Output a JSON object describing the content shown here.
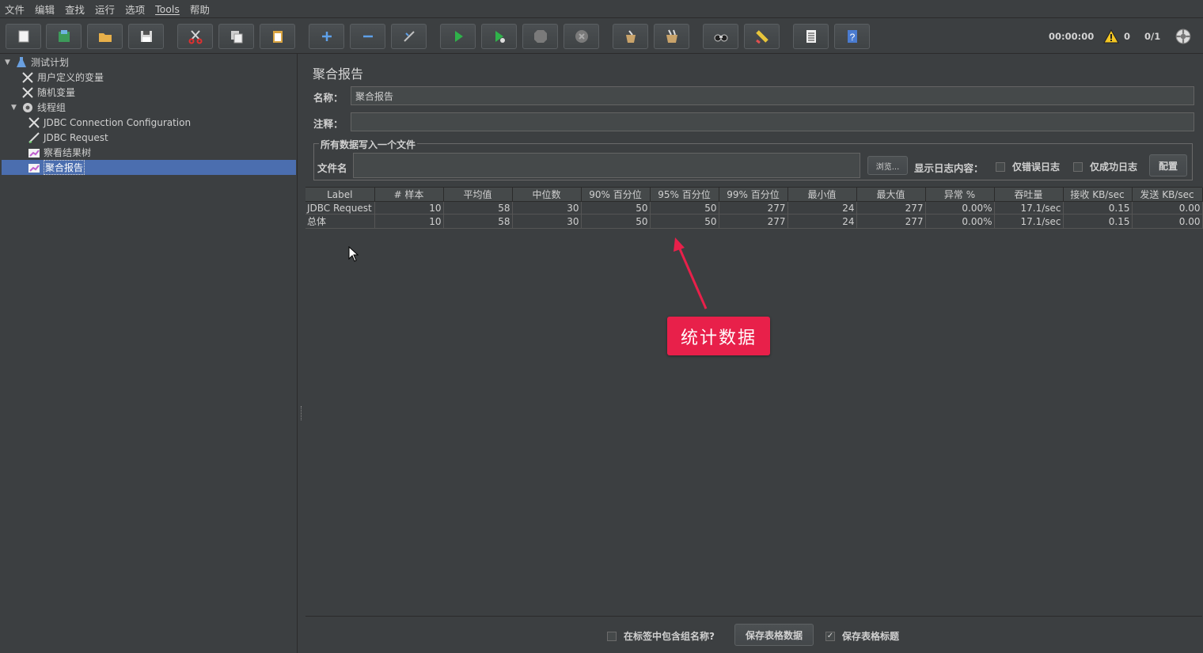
{
  "menu": [
    "文件",
    "编辑",
    "查找",
    "运行",
    "选项",
    "Tools",
    "帮助"
  ],
  "toolbar": {
    "buttons": [
      "new-file-icon",
      "template-icon",
      "open-folder-icon",
      "save-icon",
      "cut-icon",
      "copy-icon",
      "paste-icon",
      "expand-icon",
      "collapse-icon",
      "toggle-icon",
      "start-icon",
      "start-no-pause-icon",
      "stop-icon",
      "shutdown-icon",
      "clear-icon",
      "clear-all-icon",
      "search-icon",
      "reset-search-icon",
      "function-helper-icon",
      "help-icon"
    ],
    "elapsed_time": "00:00:00",
    "warning_count": "0",
    "threads": "0/1"
  },
  "tree": [
    {
      "label": "测试计划",
      "icon": "test-plan-icon",
      "expanded": true,
      "level": 0
    },
    {
      "label": "用户定义的变量",
      "icon": "config-element-icon",
      "level": 1
    },
    {
      "label": "随机变量",
      "icon": "config-element-icon",
      "level": 1
    },
    {
      "label": "线程组",
      "icon": "thread-group-icon",
      "expanded": true,
      "level": 1
    },
    {
      "label": "JDBC Connection Configuration",
      "icon": "config-element-icon",
      "level": 2
    },
    {
      "label": "JDBC Request",
      "icon": "sampler-icon",
      "level": 2
    },
    {
      "label": "察看结果树",
      "icon": "listener-icon",
      "level": 2
    },
    {
      "label": "聚合报告",
      "icon": "listener-icon",
      "level": 2,
      "selected": true
    }
  ],
  "panel": {
    "title": "聚合报告",
    "name_label": "名称：",
    "name_value": "聚合报告",
    "comment_label": "注释：",
    "comment_value": "",
    "file_group_legend": "所有数据写入一个文件",
    "filename_label": "文件名",
    "filename_value": "",
    "browse_button": "浏览...",
    "log_content_label": "显示日志内容：",
    "errors_only_label": "仅错误日志",
    "success_only_label": "仅成功日志",
    "configure_button": "配置"
  },
  "table": {
    "headers": [
      "Label",
      "# 样本",
      "平均值",
      "中位数",
      "90% 百分位",
      "95% 百分位",
      "99% 百分位",
      "最小值",
      "最大值",
      "异常 %",
      "吞吐量",
      "接收 KB/sec",
      "发送 KB/sec"
    ],
    "rows": [
      [
        "JDBC Request",
        "10",
        "58",
        "30",
        "50",
        "50",
        "277",
        "24",
        "277",
        "0.00%",
        "17.1/sec",
        "0.15",
        "0.00"
      ],
      [
        "总体",
        "10",
        "58",
        "30",
        "50",
        "50",
        "277",
        "24",
        "277",
        "0.00%",
        "17.1/sec",
        "0.15",
        "0.00"
      ]
    ]
  },
  "bottom": {
    "include_group_label": "在标签中包含组名称?",
    "include_group_checked": false,
    "save_table_button": "保存表格数据",
    "save_header_label": "保存表格标题",
    "save_header_checked": true
  },
  "annotation": {
    "text": "统计数据",
    "color": "#e8204a"
  },
  "colors": {
    "background": "#3c3f41",
    "selection": "#4b6eaf",
    "accent": "#e8204a"
  }
}
